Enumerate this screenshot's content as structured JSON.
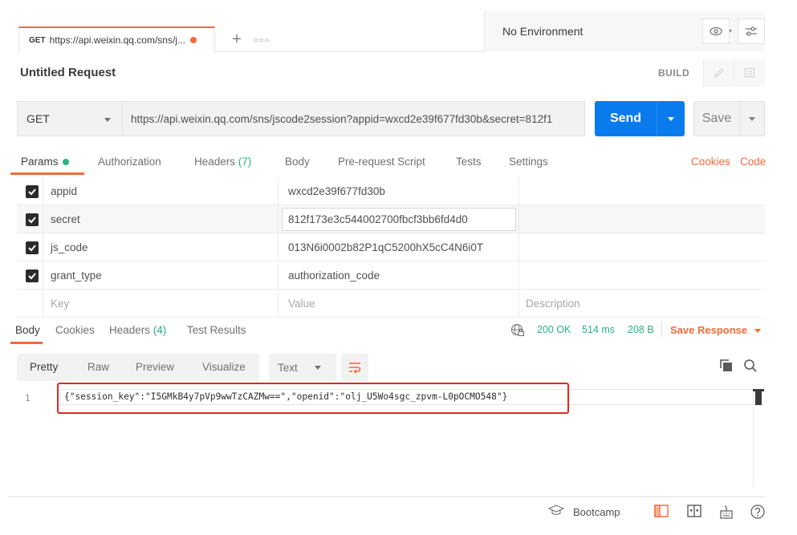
{
  "tab": {
    "method": "GET",
    "url": "https://api.weixin.qq.com/sns/j..."
  },
  "environment": {
    "selected": "No Environment"
  },
  "request": {
    "title": "Untitled Request",
    "build_label": "BUILD",
    "method": "GET",
    "url": "https://api.weixin.qq.com/sns/jscode2session?appid=wxcd2e39f677fd30b&secret=812f1",
    "send_label": "Send",
    "save_label": "Save"
  },
  "request_tabs": {
    "params": "Params",
    "authorization": "Authorization",
    "headers": "Headers",
    "headers_count": "(7)",
    "body": "Body",
    "prerequest": "Pre-request Script",
    "tests": "Tests",
    "settings": "Settings",
    "cookies": "Cookies",
    "code": "Code"
  },
  "params": {
    "rows": [
      {
        "key": "appid",
        "value": "wxcd2e39f677fd30b",
        "checked": true
      },
      {
        "key": "secret",
        "value": "812f173e3c544002700fbcf3bb6fd4d0",
        "checked": true
      },
      {
        "key": "js_code",
        "value": "013N6i0002b82P1qC5200hX5cC4N6i0T",
        "checked": true
      },
      {
        "key": "grant_type",
        "value": "authorization_code",
        "checked": true
      }
    ],
    "placeholder_key": "Key",
    "placeholder_value": "Value",
    "placeholder_description": "Description"
  },
  "response_tabs": {
    "body": "Body",
    "cookies": "Cookies",
    "headers": "Headers",
    "headers_count": "(4)",
    "test_results": "Test Results"
  },
  "response_status": {
    "status": "200 OK",
    "time": "514 ms",
    "size": "208 B",
    "save_response": "Save Response"
  },
  "response_view": {
    "pretty": "Pretty",
    "raw": "Raw",
    "preview": "Preview",
    "visualize": "Visualize",
    "format": "Text"
  },
  "response_body": {
    "line_number": "1",
    "content": "{\"session_key\":\"I5GMkB4y7pVp9wwTzCAZMw==\",\"openid\":\"olj_U5Wo4sgc_zpvm-L0pOCMO548\"}"
  },
  "footer": {
    "bootcamp": "Bootcamp"
  },
  "colors": {
    "accent": "#f26b3a",
    "send": "#097bed",
    "success": "#26b47f",
    "highlight": "#e2271e"
  }
}
